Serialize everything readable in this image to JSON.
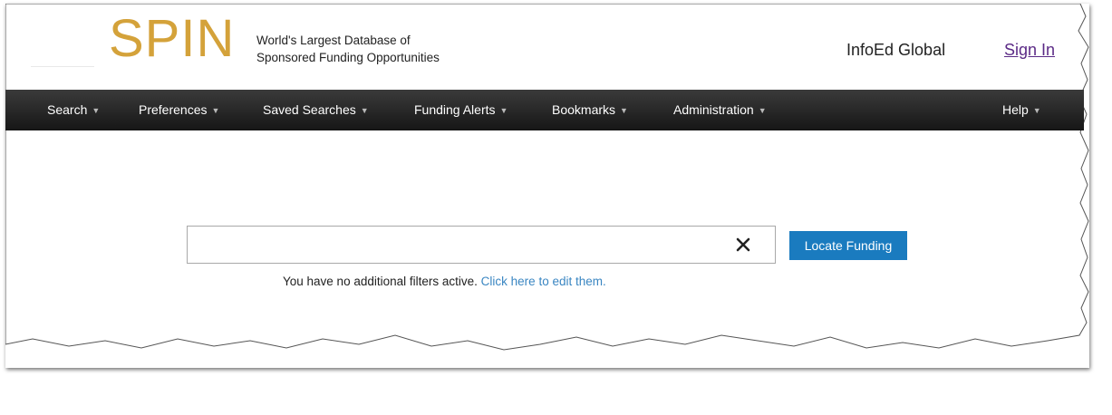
{
  "header": {
    "logo_text": "SPIN",
    "tagline_line1": "World's Largest Database of",
    "tagline_line2": "Sponsored Funding Opportunities",
    "org_name": "InfoEd Global",
    "sign_in_label": "Sign In"
  },
  "nav": {
    "items": [
      {
        "label": "Search"
      },
      {
        "label": "Preferences"
      },
      {
        "label": "Saved Searches"
      },
      {
        "label": "Funding Alerts"
      },
      {
        "label": "Bookmarks"
      },
      {
        "label": "Administration"
      },
      {
        "label": "Help"
      }
    ],
    "caret_glyph": "▼"
  },
  "search": {
    "value": "",
    "placeholder": "",
    "clear_icon": "close-icon",
    "button_label": "Locate Funding"
  },
  "filters": {
    "note_text": "You have no additional filters active.",
    "link_text": "Click here to edit them."
  },
  "colors": {
    "logo": "#d4a23a",
    "sign_in_link": "#5b2a86",
    "nav_background": "#222222",
    "button": "#1a7bbf",
    "link": "#3a86c2"
  }
}
